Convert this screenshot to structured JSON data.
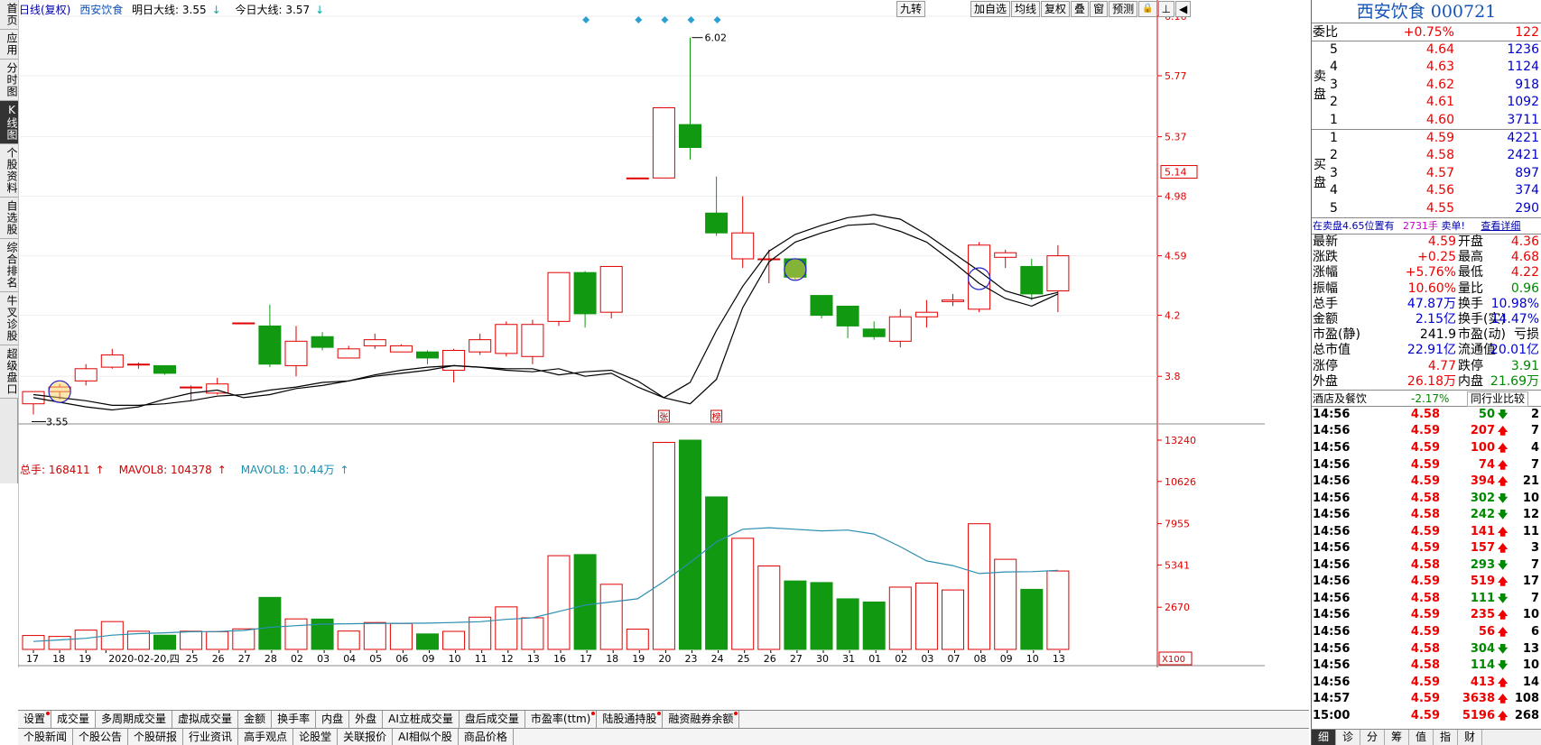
{
  "vertical_nav": [
    {
      "label": "首页",
      "name": "nav-home"
    },
    {
      "label": "应用",
      "name": "nav-apps"
    },
    {
      "label": "分时图",
      "name": "nav-intraday"
    },
    {
      "label": "K线图",
      "name": "nav-kline"
    },
    {
      "label": "个股资料",
      "name": "nav-stock-info"
    },
    {
      "label": "自选股",
      "name": "nav-watchlist"
    },
    {
      "label": "综合排名",
      "name": "nav-ranking"
    },
    {
      "label": "牛叉诊股",
      "name": "nav-diagnosis"
    },
    {
      "label": "超级盘口",
      "name": "nav-super-book"
    }
  ],
  "header": {
    "period": "日线(复权)",
    "stock_name": "西安饮食",
    "tomorrow_label": "明日大线: 3.55",
    "today_label": "今日大线: 3.57"
  },
  "toolbar": {
    "nine_turn": "九转",
    "buttons": [
      "加自选",
      "均线",
      "复权",
      "叠",
      "窗",
      "预测"
    ]
  },
  "price_axis": [
    6.16,
    5.77,
    5.37,
    4.98,
    4.59,
    4.2,
    3.8
  ],
  "current_price_tag": "5.14",
  "price_annotations": {
    "high": "6.02",
    "low": "3.55"
  },
  "event_markers": [
    "张",
    "榜"
  ],
  "volume_header": {
    "total": "总手: 168411",
    "mavol1": "MAVOL8: 104378",
    "mavol2": "MAVOL8: 10.44万"
  },
  "volume_axis": [
    13240,
    10626,
    7955,
    5341,
    2670
  ],
  "volume_unit": "X100",
  "x_axis_labels": [
    "17",
    "18",
    "19",
    "2020-02-20,四",
    "25",
    "26",
    "27",
    "28",
    "02",
    "03",
    "04",
    "05",
    "06",
    "09",
    "10",
    "11",
    "12",
    "13",
    "16",
    "17",
    "18",
    "19",
    "20",
    "23",
    "24",
    "25",
    "26",
    "27",
    "30",
    "31",
    "01",
    "02",
    "03",
    "07",
    "08",
    "09",
    "10",
    "13"
  ],
  "chart_data": {
    "type": "candlestick",
    "candles": [
      {
        "o": 3.62,
        "c": 3.7,
        "h": 3.7,
        "l": 3.55
      },
      {
        "o": 3.7,
        "c": 3.73,
        "h": 3.75,
        "l": 3.65
      },
      {
        "o": 3.77,
        "c": 3.85,
        "h": 3.88,
        "l": 3.74
      },
      {
        "o": 3.86,
        "c": 3.94,
        "h": 3.98,
        "l": 3.85
      },
      {
        "o": 3.88,
        "c": 3.88,
        "h": 3.89,
        "l": 3.85
      },
      {
        "o": 3.87,
        "c": 3.82,
        "h": 3.87,
        "l": 3.81
      },
      {
        "o": 3.73,
        "c": 3.73,
        "h": 3.74,
        "l": 3.64
      },
      {
        "o": 3.69,
        "c": 3.75,
        "h": 3.79,
        "l": 3.68
      },
      {
        "o": 4.15,
        "c": 4.15,
        "h": 4.15,
        "l": 4.15
      },
      {
        "o": 4.13,
        "c": 3.88,
        "h": 4.27,
        "l": 3.86
      },
      {
        "o": 3.87,
        "c": 4.03,
        "h": 4.13,
        "l": 3.8
      },
      {
        "o": 4.06,
        "c": 3.99,
        "h": 4.09,
        "l": 3.97
      },
      {
        "o": 3.92,
        "c": 3.98,
        "h": 4.0,
        "l": 3.92
      },
      {
        "o": 4.0,
        "c": 4.04,
        "h": 4.08,
        "l": 3.98
      },
      {
        "o": 3.96,
        "c": 4.0,
        "h": 4.01,
        "l": 3.96
      },
      {
        "o": 3.96,
        "c": 3.92,
        "h": 3.97,
        "l": 3.88
      },
      {
        "o": 3.84,
        "c": 3.97,
        "h": 3.98,
        "l": 3.76
      },
      {
        "o": 3.96,
        "c": 4.04,
        "h": 4.08,
        "l": 3.94
      },
      {
        "o": 3.95,
        "c": 4.14,
        "h": 4.16,
        "l": 3.93
      },
      {
        "o": 3.93,
        "c": 4.14,
        "h": 4.17,
        "l": 3.88
      },
      {
        "o": 4.16,
        "c": 4.48,
        "h": 4.48,
        "l": 4.13
      },
      {
        "o": 4.48,
        "c": 4.21,
        "h": 4.49,
        "l": 4.12
      },
      {
        "o": 4.22,
        "c": 4.52,
        "h": 4.52,
        "l": 4.18
      },
      {
        "o": 5.1,
        "c": 5.1,
        "h": 5.1,
        "l": 5.1
      },
      {
        "o": 5.1,
        "c": 5.56,
        "h": 5.56,
        "l": 5.1
      },
      {
        "o": 5.45,
        "c": 5.3,
        "h": 6.02,
        "l": 5.22
      },
      {
        "o": 4.87,
        "c": 4.74,
        "h": 5.11,
        "l": 4.72
      },
      {
        "o": 4.57,
        "c": 4.74,
        "h": 4.98,
        "l": 4.51
      },
      {
        "o": 4.57,
        "c": 4.57,
        "h": 4.63,
        "l": 4.41
      },
      {
        "o": 4.57,
        "c": 4.45,
        "h": 4.57,
        "l": 4.43
      },
      {
        "o": 4.33,
        "c": 4.2,
        "h": 4.33,
        "l": 4.18
      },
      {
        "o": 4.26,
        "c": 4.13,
        "h": 4.26,
        "l": 4.05
      },
      {
        "o": 4.11,
        "c": 4.06,
        "h": 4.16,
        "l": 4.04
      },
      {
        "o": 4.03,
        "c": 4.19,
        "h": 4.24,
        "l": 3.99
      },
      {
        "o": 4.19,
        "c": 4.22,
        "h": 4.3,
        "l": 4.12
      },
      {
        "o": 4.29,
        "c": 4.3,
        "h": 4.34,
        "l": 4.26
      },
      {
        "o": 4.24,
        "c": 4.66,
        "h": 4.68,
        "l": 4.22
      },
      {
        "o": 4.58,
        "c": 4.61,
        "h": 4.63,
        "l": 4.51
      },
      {
        "o": 4.52,
        "c": 4.34,
        "h": 4.57,
        "l": 4.3
      },
      {
        "o": 4.36,
        "c": 4.59,
        "h": 4.66,
        "l": 4.22
      }
    ],
    "ma_fast": [
      3.66,
      3.63,
      3.6,
      3.58,
      3.6,
      3.65,
      3.69,
      3.71,
      3.66,
      3.68,
      3.72,
      3.74,
      3.77,
      3.81,
      3.84,
      3.86,
      3.87,
      3.86,
      3.84,
      3.83,
      3.85,
      3.8,
      3.82,
      3.73,
      3.66,
      3.76,
      4.1,
      4.39,
      4.62,
      4.73,
      4.79,
      4.84,
      4.86,
      4.83,
      4.73,
      4.61,
      4.49,
      4.36,
      4.31,
      4.35
    ],
    "ma_slow": [
      3.68,
      3.66,
      3.64,
      3.61,
      3.61,
      3.62,
      3.64,
      3.67,
      3.68,
      3.71,
      3.73,
      3.76,
      3.77,
      3.8,
      3.82,
      3.84,
      3.87,
      3.86,
      3.85,
      3.85,
      3.81,
      3.83,
      3.84,
      3.77,
      3.66,
      3.62,
      3.78,
      4.25,
      4.55,
      4.68,
      4.74,
      4.79,
      4.8,
      4.75,
      4.68,
      4.55,
      4.41,
      4.31,
      4.26,
      4.34
    ],
    "volume": [
      880,
      820,
      1220,
      1760,
      1150,
      900,
      1150,
      1120,
      1300,
      3290,
      1930,
      1920,
      1160,
      1700,
      1640,
      980,
      1140,
      2040,
      2690,
      2000,
      5930,
      6000,
      4120,
      1280,
      13100,
      13240,
      9650,
      7030,
      5280,
      4330,
      4230,
      3200,
      3000,
      3940,
      4200,
      3760,
      7950,
      5700,
      3800,
      4960
    ],
    "volume_ma": [
      500,
      600,
      700,
      900,
      1000,
      1050,
      1120,
      1130,
      1200,
      1400,
      1500,
      1600,
      1620,
      1650,
      1650,
      1660,
      1700,
      1750,
      1900,
      2000,
      2400,
      2800,
      3000,
      3200,
      4300,
      5500,
      6800,
      7600,
      7700,
      7600,
      7500,
      7550,
      7300,
      6500,
      5600,
      5300,
      4800,
      4900,
      4920,
      5000
    ],
    "price_range": [
      3.5,
      6.16
    ],
    "volume_range": [
      0,
      13240
    ]
  },
  "right_panel": {
    "title": "西安饮食 000721",
    "weibi": {
      "label": "委比",
      "pct": "+0.75%",
      "diff": "122"
    },
    "sell_label": "卖盘",
    "buy_label": "买盘",
    "sell": [
      {
        "lv": "5",
        "price": "4.64",
        "vol": "1236"
      },
      {
        "lv": "4",
        "price": "4.63",
        "vol": "1124"
      },
      {
        "lv": "3",
        "price": "4.62",
        "vol": "918"
      },
      {
        "lv": "2",
        "price": "4.61",
        "vol": "1092"
      },
      {
        "lv": "1",
        "price": "4.60",
        "vol": "3711"
      }
    ],
    "buy": [
      {
        "lv": "1",
        "price": "4.59",
        "vol": "4221"
      },
      {
        "lv": "2",
        "price": "4.58",
        "vol": "2421"
      },
      {
        "lv": "3",
        "price": "4.57",
        "vol": "897"
      },
      {
        "lv": "4",
        "price": "4.56",
        "vol": "374"
      },
      {
        "lv": "5",
        "price": "4.55",
        "vol": "290"
      }
    ],
    "note": {
      "text1": "在卖盘4.65位置有",
      "qty": "2731手",
      "text2": "卖单!",
      "link": "查看详细"
    },
    "quotes": [
      {
        "l1": "最新",
        "v1": "4.59",
        "c1": "red",
        "l2": "开盘",
        "v2": "4.36",
        "c2": "red"
      },
      {
        "l1": "涨跌",
        "v1": "+0.25",
        "c1": "red",
        "l2": "最高",
        "v2": "4.68",
        "c2": "red"
      },
      {
        "l1": "涨幅",
        "v1": "+5.76%",
        "c1": "red",
        "l2": "最低",
        "v2": "4.22",
        "c2": "red"
      },
      {
        "l1": "振幅",
        "v1": "10.60%",
        "c1": "red",
        "l2": "量比",
        "v2": "0.96",
        "c2": "grn"
      },
      {
        "l1": "总手",
        "v1": "47.87万",
        "c1": "blu",
        "l2": "换手",
        "v2": "10.98%",
        "c2": "blu"
      },
      {
        "l1": "金额",
        "v1": "2.15亿",
        "c1": "blu",
        "l2": "换手(实)",
        "v2": "14.47%",
        "c2": "blu"
      },
      {
        "l1": "市盈(静)",
        "v1": "241.9",
        "c1": "",
        "l2": "市盈(动)",
        "v2": "亏损",
        "c2": ""
      },
      {
        "l1": "总市值",
        "v1": "22.91亿",
        "c1": "blu",
        "l2": "流通值",
        "v2": "20.01亿",
        "c2": "blu"
      },
      {
        "l1": "涨停",
        "v1": "4.77",
        "c1": "red",
        "l2": "跌停",
        "v2": "3.91",
        "c2": "grn"
      },
      {
        "l1": "外盘",
        "v1": "26.18万",
        "c1": "red",
        "l2": "内盘",
        "v2": "21.69万",
        "c2": "grn"
      }
    ],
    "industry": {
      "name": "酒店及餐饮",
      "pct": "-2.17%",
      "compare": "同行业比较"
    },
    "trades": [
      {
        "t": "14:56",
        "p": "4.58",
        "v": "50",
        "d": "down",
        "c": "2"
      },
      {
        "t": "14:56",
        "p": "4.59",
        "v": "207",
        "d": "up",
        "c": "7"
      },
      {
        "t": "14:56",
        "p": "4.59",
        "v": "100",
        "d": "up",
        "c": "4"
      },
      {
        "t": "14:56",
        "p": "4.59",
        "v": "74",
        "d": "up",
        "c": "7"
      },
      {
        "t": "14:56",
        "p": "4.59",
        "v": "394",
        "d": "up",
        "c": "21"
      },
      {
        "t": "14:56",
        "p": "4.58",
        "v": "302",
        "d": "down",
        "c": "10"
      },
      {
        "t": "14:56",
        "p": "4.58",
        "v": "242",
        "d": "down",
        "c": "12"
      },
      {
        "t": "14:56",
        "p": "4.59",
        "v": "141",
        "d": "up",
        "c": "11"
      },
      {
        "t": "14:56",
        "p": "4.59",
        "v": "157",
        "d": "up",
        "c": "3"
      },
      {
        "t": "14:56",
        "p": "4.58",
        "v": "293",
        "d": "down",
        "c": "7"
      },
      {
        "t": "14:56",
        "p": "4.59",
        "v": "519",
        "d": "up",
        "c": "17"
      },
      {
        "t": "14:56",
        "p": "4.58",
        "v": "111",
        "d": "down",
        "c": "7"
      },
      {
        "t": "14:56",
        "p": "4.59",
        "v": "235",
        "d": "up",
        "c": "10"
      },
      {
        "t": "14:56",
        "p": "4.59",
        "v": "56",
        "d": "up",
        "c": "6"
      },
      {
        "t": "14:56",
        "p": "4.58",
        "v": "304",
        "d": "down",
        "c": "13"
      },
      {
        "t": "14:56",
        "p": "4.58",
        "v": "114",
        "d": "down",
        "c": "10"
      },
      {
        "t": "14:56",
        "p": "4.59",
        "v": "413",
        "d": "up",
        "c": "14"
      },
      {
        "t": "14:57",
        "p": "4.59",
        "v": "3638",
        "d": "up",
        "c": "108"
      },
      {
        "t": "15:00",
        "p": "4.59",
        "v": "5196",
        "d": "up",
        "c": "268"
      }
    ],
    "tabs": [
      "细",
      "诊",
      "分",
      "筹",
      "值",
      "指",
      "财"
    ]
  },
  "bottom_tabs": [
    "设置",
    "成交量",
    "多周期成交量",
    "虚拟成交量",
    "金额",
    "换手率",
    "内盘",
    "外盘",
    "AI立桩成交量",
    "盘后成交量",
    "市盈率(ttm)",
    "陆股通持股",
    "融资融券余额"
  ],
  "bottom_links": [
    "个股新闻",
    "个股公告",
    "个股研报",
    "行业资讯",
    "高手观点",
    "论股堂",
    "关联报价",
    "AI相似个股",
    "商品价格"
  ],
  "colors": {
    "up": "#e00000",
    "down": "#119911",
    "ma": "#000000",
    "vol_ma": "#2a8fb0",
    "axis": "#e00000",
    "accent": "#1454b8"
  }
}
